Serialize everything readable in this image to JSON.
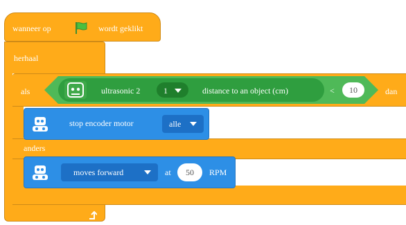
{
  "hat": {
    "before": "wanneer op",
    "after": "wordt geklikt",
    "icon": "green-flag-icon"
  },
  "loop": {
    "label": "herhaal",
    "icon": "loop-arrow-icon"
  },
  "ifelse": {
    "if_label": "als",
    "then_label": "dan",
    "else_label": "anders"
  },
  "condition": {
    "sensor": "ultrasonic 2",
    "port": "1",
    "measure": "distance to an object (cm)",
    "operator": "<",
    "value": "10"
  },
  "then_block": {
    "label": "stop encoder motor",
    "option": "alle",
    "icon": "robot-icon"
  },
  "else_block": {
    "direction": "moves forward",
    "at_label": "at",
    "speed": "50",
    "unit": "RPM",
    "icon": "robot-icon"
  },
  "colors": {
    "control": "#ffab19",
    "sensing": "#4fb958",
    "motor": "#2d8fe6"
  }
}
